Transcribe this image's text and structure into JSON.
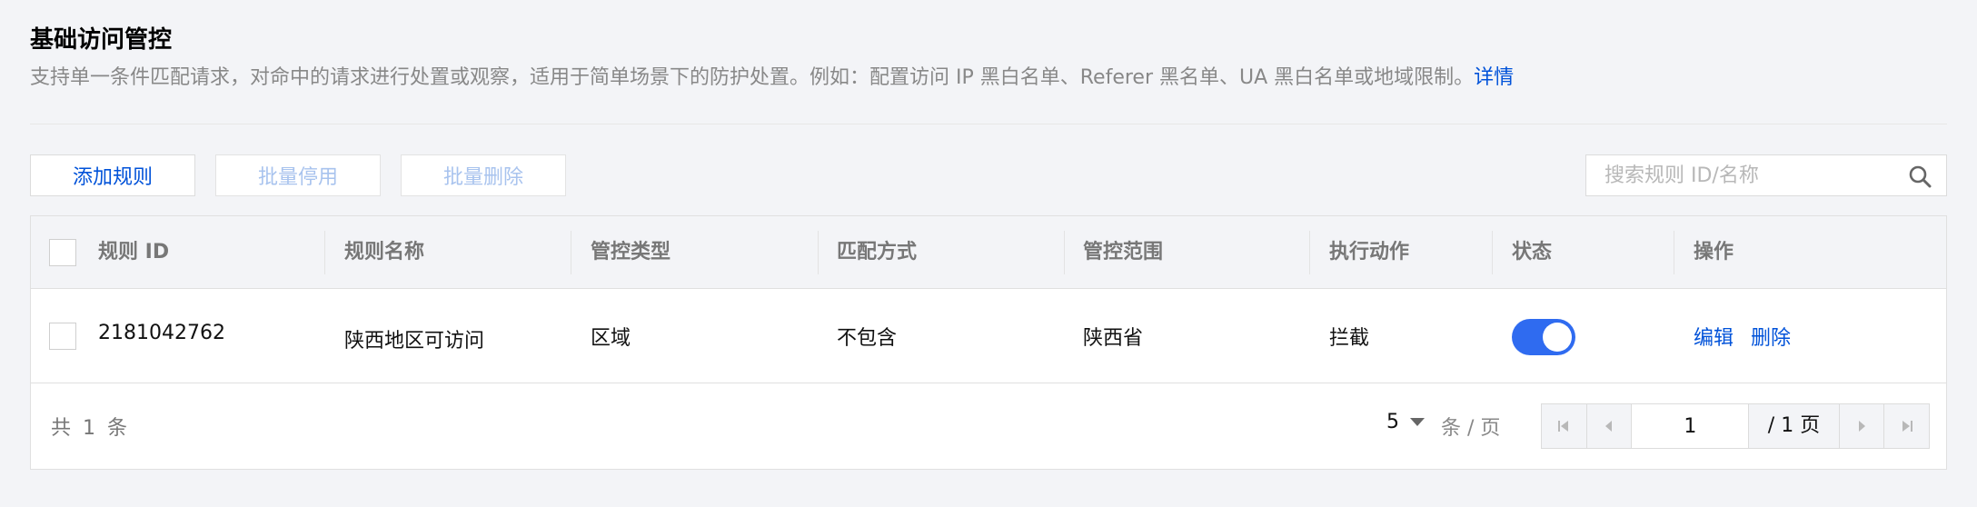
{
  "section": {
    "title": "基础访问管控",
    "description": "支持单一条件匹配请求，对命中的请求进行处置或观察，适用于简单场景下的防护处置。例如：配置访问 IP 黑白名单、Referer 黑名单、UA 黑白名单或地域限制。",
    "detail_link": "详情"
  },
  "toolbar": {
    "add_label": "添加规则",
    "disable_label": "批量停用",
    "delete_label": "批量删除",
    "search_placeholder": "搜索规则 ID/名称"
  },
  "table": {
    "columns": [
      "规则 ID",
      "规则名称",
      "管控类型",
      "匹配方式",
      "管控范围",
      "执行动作",
      "状态",
      "操作"
    ],
    "rows": [
      {
        "rule_id": "2181042762",
        "rule_name": "陕西地区可访问",
        "control_type": "区域",
        "match_mode": "不包含",
        "scope": "陕西省",
        "action": "拦截",
        "enabled": true,
        "edit_label": "编辑",
        "delete_label": "删除"
      }
    ]
  },
  "pagination": {
    "total_text": "共 1 条",
    "page_size": "5",
    "per_page_label": "条 / 页",
    "current_page": "1",
    "total_pages_label": "/ 1 页"
  },
  "colors": {
    "accent": "#0052d9",
    "toggle_on": "#2f6bf0",
    "header_bg": "#f3f4f7"
  }
}
